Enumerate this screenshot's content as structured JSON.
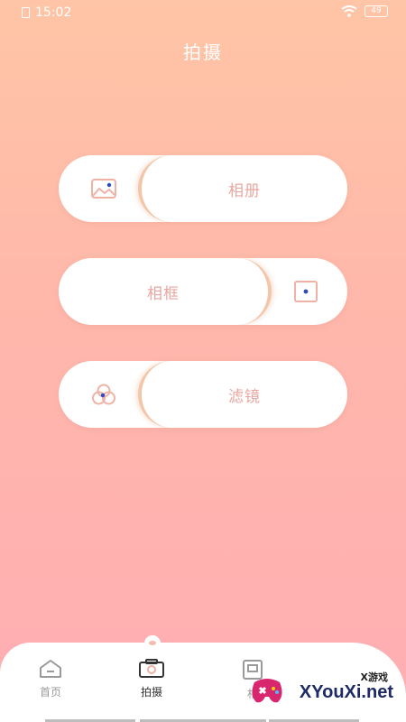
{
  "status": {
    "time": "15:02",
    "battery": "49"
  },
  "header": {
    "title": "拍摄"
  },
  "buttons": {
    "album_label": "相册",
    "frame_label": "相框",
    "filter_label": "滤镜"
  },
  "nav": {
    "items": [
      {
        "label": "首页",
        "icon": "home-icon"
      },
      {
        "label": "拍摄",
        "icon": "camera-icon"
      },
      {
        "label": "相",
        "icon": "frame-icon"
      }
    ]
  },
  "watermark": {
    "sub": "X游戏",
    "main": "XYouXi.net"
  },
  "colors": {
    "accent_text": "#e9a7a0",
    "icon_stroke": "#f0b2a4",
    "dot_blue": "#2e49c4"
  }
}
